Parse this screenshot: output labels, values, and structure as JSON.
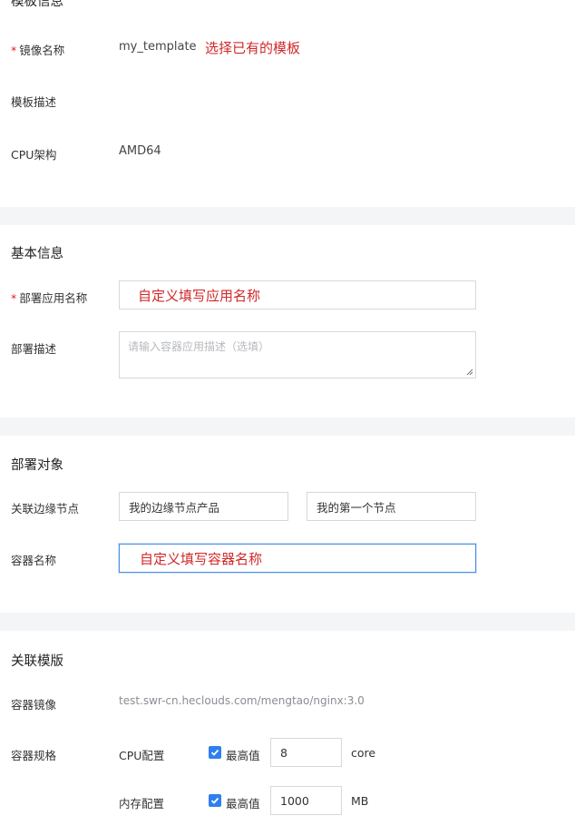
{
  "template_section": {
    "top_cut_label": "模板信息",
    "image_name_label": "镜像名称",
    "image_name_value": "my_template",
    "image_name_annotation": "选择已有的模板",
    "template_desc_label": "模板描述",
    "cpu_arch_label": "CPU架构",
    "cpu_arch_value": "AMD64"
  },
  "basic_info": {
    "title": "基本信息",
    "app_name_label": "部署应用名称",
    "app_name_annotation": "自定义填写应用名称",
    "desc_label": "部署描述",
    "desc_placeholder": "请输入容器应用描述（选填）"
  },
  "deploy_target": {
    "title": "部署对象",
    "edge_node_label": "关联边缘节点",
    "product_value": "我的边缘节点产品",
    "node_value": "我的第一个节点",
    "container_name_label": "容器名称",
    "container_name_annotation": "自定义填写容器名称"
  },
  "linked_template": {
    "title": "关联模版",
    "container_image_label": "容器镜像",
    "container_image_value": "test.swr-cn.heclouds.com/mengtao/nginx:3.0",
    "spec_label": "容器规格",
    "cpu_config_label": "CPU配置",
    "cpu_max_label": "最高值",
    "cpu_value": "8",
    "cpu_unit": "core",
    "mem_config_label": "内存配置",
    "mem_max_label": "最高值",
    "mem_value": "1000",
    "mem_unit": "MB"
  },
  "colors": {
    "required": "#e02020",
    "annotation": "#d0282a",
    "checkbox": "#2f80ed",
    "focus_border": "#4a90e2",
    "gap_bg": "#f4f5f7"
  }
}
